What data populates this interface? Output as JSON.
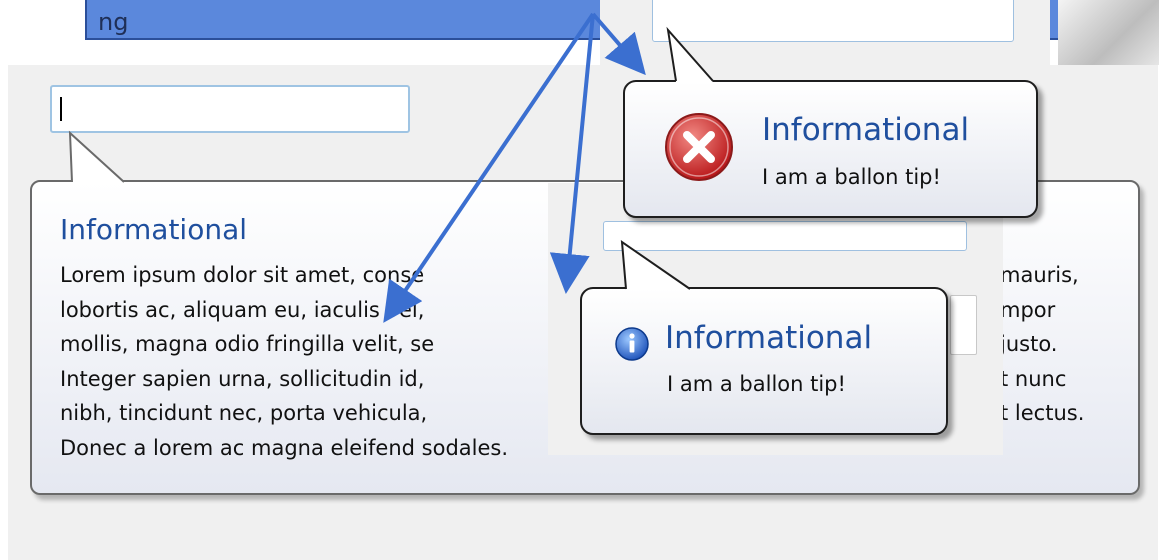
{
  "banner": {
    "text": "ng"
  },
  "big_balloon": {
    "title": "Informational",
    "lines": [
      "Lorem ipsum dolor sit amet, conse",
      "lobortis ac, aliquam eu, iaculis vel, ",
      "mollis, magna odio fringilla velit, se",
      "Integer sapien urna, sollicitudin id,",
      "nibh, tincidunt nec, porta vehicula,",
      "Donec a lorem ac magna eleifend sodales."
    ],
    "line_tails": [
      "mauris,",
      "mpor",
      "justo.",
      "t nunc",
      "t lectus.",
      ""
    ]
  },
  "error_balloon": {
    "title": "Informational",
    "text": "I am a ballon tip!",
    "icon": "error-icon"
  },
  "info_balloon": {
    "title": "Informational",
    "text": "I am a ballon tip!",
    "icon": "info-icon"
  },
  "colors": {
    "title_blue": "#1f4f9e",
    "arrow_blue": "#3b6fd0",
    "banner_blue": "#5b88dc"
  }
}
